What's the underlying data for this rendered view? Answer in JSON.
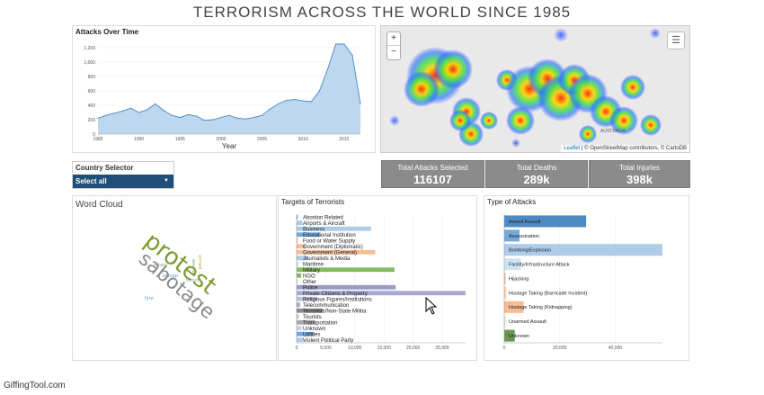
{
  "page": {
    "title": "TERRORISM ACROSS THE WORLD SINCE 1985",
    "watermark": "GiffingTool.com"
  },
  "line_chart": {
    "title": "Attacks Over Time",
    "xlabel": "Year",
    "yticks": [
      "0",
      "200",
      "400",
      "600",
      "800",
      "1,000",
      "1,200"
    ],
    "xticks": [
      "1985",
      "1990",
      "1995",
      "2000",
      "2005",
      "2010",
      "2015"
    ],
    "chart_data": {
      "type": "area",
      "x": [
        1985,
        1986,
        1987,
        1988,
        1989,
        1990,
        1991,
        1992,
        1993,
        1994,
        1995,
        1996,
        1997,
        1998,
        1999,
        2000,
        2001,
        2002,
        2003,
        2004,
        2005,
        2006,
        2007,
        2008,
        2009,
        2010,
        2011,
        2012,
        2013,
        2014,
        2015,
        2016,
        2017
      ],
      "y": [
        220,
        260,
        290,
        320,
        360,
        300,
        340,
        420,
        330,
        260,
        230,
        270,
        250,
        190,
        200,
        230,
        260,
        220,
        210,
        230,
        260,
        350,
        420,
        470,
        480,
        460,
        450,
        600,
        900,
        1250,
        1250,
        1100,
        420
      ],
      "ylim": [
        0,
        1300
      ],
      "color": "#5b9bd5"
    }
  },
  "map": {
    "zoom_in": "+",
    "zoom_out": "−",
    "layers_icon": "layers-icon",
    "attribution": {
      "leaflet": "Leaflet",
      "text": " | © OpenStreetMap contributors, © CartoDB"
    },
    "label_australia": "AUSTRALIA"
  },
  "selector": {
    "label": "Country Selector",
    "value": "Select all"
  },
  "stats": [
    {
      "label": "Total Attacks Selected",
      "value": "116107"
    },
    {
      "label": "Total Deaths",
      "value": "289k"
    },
    {
      "label": "Total Injuries",
      "value": "398k"
    }
  ],
  "word_cloud": {
    "title": "Word Cloud",
    "words": [
      "protest",
      "sabotage"
    ]
  },
  "targets": {
    "title": "Targets of Terrorists",
    "xticks": [
      "0",
      "5,000",
      "10,000",
      "15,000",
      "20,000",
      "25,000"
    ],
    "chart_data": {
      "type": "bar",
      "categories": [
        "Abortion Related",
        "Airports & Aircraft",
        "Business",
        "Educational Institution",
        "Food or Water Supply",
        "Government (Diplomatic)",
        "Government (General)",
        "Journalists & Media",
        "Maritime",
        "Military",
        "NGO",
        "Other",
        "Police",
        "Private Citizens & Property",
        "Religious Figures/Institutions",
        "Telecommunication",
        "Terrorists/Non-State Militia",
        "Tourists",
        "Transportation",
        "Unknown",
        "Utilities",
        "Violent Political Party"
      ],
      "values": [
        200,
        1000,
        12800,
        4000,
        200,
        1500,
        13500,
        2000,
        300,
        16800,
        800,
        100,
        17000,
        29000,
        3500,
        600,
        4500,
        400,
        3200,
        900,
        3000,
        1200
      ],
      "colors": [
        "#5b9bd5",
        "#9dc3e6",
        "#9dc3e6",
        "#5b9bd5",
        "#f4b183",
        "#f4b183",
        "#f4b183",
        "#9dc3e6",
        "#bdd7ee",
        "#70ad47",
        "#70ad47",
        "#c5c5c5",
        "#8888bb",
        "#9999cc",
        "#b4b4d8",
        "#9999cc",
        "#777777",
        "#bbbbbb",
        "#999999",
        "#c9c9e9",
        "#5b9bd5",
        "#9dc3e6"
      ],
      "xlim": [
        0,
        29000
      ]
    }
  },
  "attack_types": {
    "title": "Type of Attacks",
    "xticks": [
      "0",
      "20,000",
      "40,000"
    ],
    "chart_data": {
      "type": "bar",
      "categories": [
        "Armed Assault",
        "Assassination",
        "Bombing/Explosion",
        "Facility/Infrastructure Attack",
        "Hijacking",
        "Hostage Taking (Barricade Incident)",
        "Hostage Taking (Kidnapping)",
        "Unarmed Assault",
        "Unknown"
      ],
      "values": [
        29500,
        5500,
        57000,
        6000,
        500,
        800,
        7000,
        700,
        3800
      ],
      "colors": [
        "#2e75b6",
        "#5b9bd5",
        "#9dc3e6",
        "#c5dff2",
        "#f4b183",
        "#f8cbad",
        "#f4b183",
        "#e2efda",
        "#548235"
      ],
      "xlim": [
        0,
        57000
      ]
    }
  }
}
